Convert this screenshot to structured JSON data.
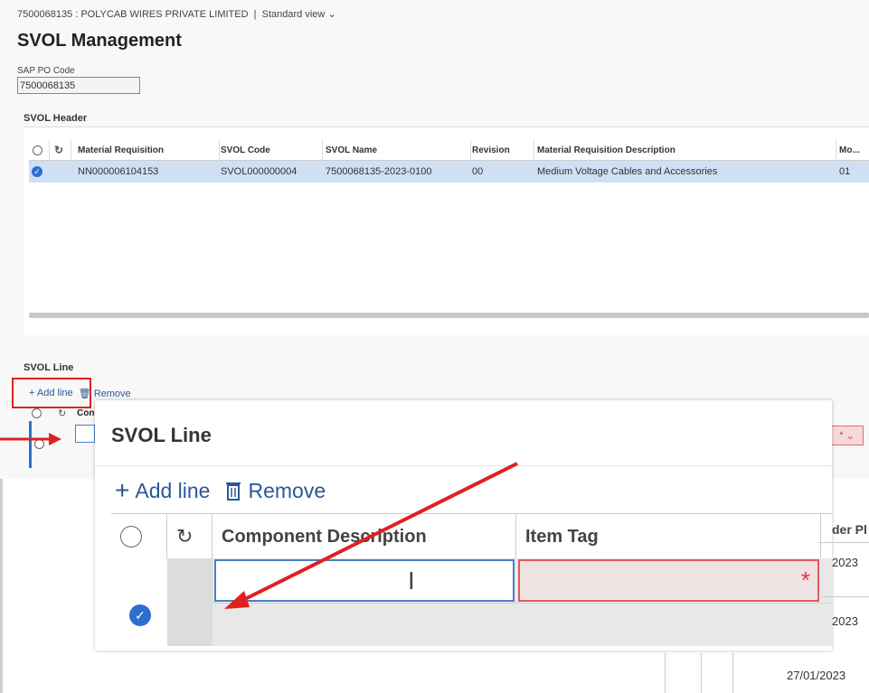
{
  "breadcrumb": {
    "text": "7500068135 : POLYCAB WIRES PRIVATE LIMITED",
    "view": "Standard view"
  },
  "page_title": "SVOL Management",
  "sap_po_code": {
    "label": "SAP PO Code",
    "value": "7500068135"
  },
  "svol_header": {
    "title": "SVOL Header",
    "columns": [
      "Material Requisition",
      "SVOL Code",
      "SVOL Name",
      "Revision",
      "Material Requisition Description",
      "Mo..."
    ],
    "rows": [
      {
        "material_requisition": "NN000006104153",
        "svol_code": "SVOL000000004",
        "svol_name": "7500068135-2023-0100",
        "revision": "00",
        "description": "Medium Voltage Cables and Accessories",
        "mo": "01"
      }
    ]
  },
  "svol_line_small": {
    "title": "SVOL Line",
    "add_line": "Add line",
    "remove": "Remove",
    "col_partial": "Con"
  },
  "svol_line_zoom": {
    "title": "SVOL Line",
    "add_line": "Add line",
    "remove": "Remove",
    "columns": [
      "Component Description",
      "Item Tag",
      "der Pl"
    ],
    "required_marker": "*"
  },
  "dates": [
    "2023",
    "2023",
    "27/01/2023"
  ],
  "colors": {
    "accent": "#2b6fcf",
    "highlight_row": "#cfe0f5",
    "annotation_red": "#e02020"
  }
}
